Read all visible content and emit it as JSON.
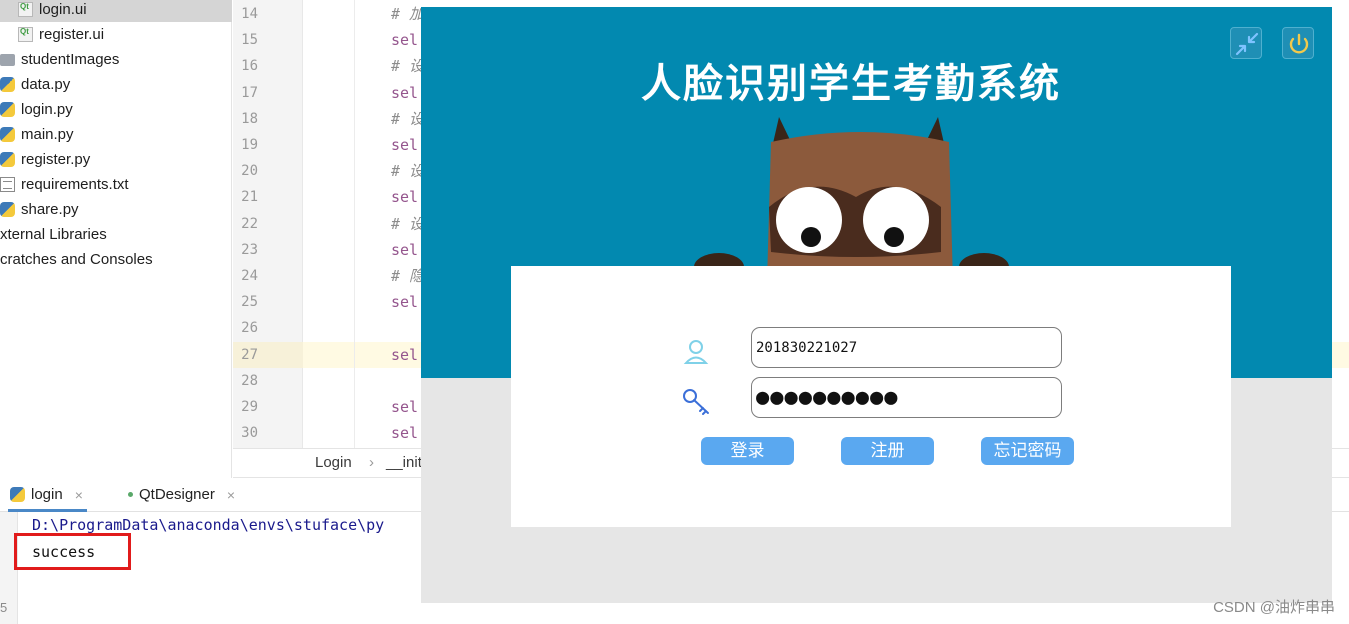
{
  "project_tree": {
    "items": [
      {
        "label": "login.ui",
        "icon": "qt-ui-file-icon",
        "indent": "deep",
        "selected": true
      },
      {
        "label": "register.ui",
        "icon": "qt-ui-file-icon",
        "indent": "deep",
        "selected": false
      },
      {
        "label": "studentImages",
        "icon": "folder-icon",
        "indent": "file",
        "selected": false
      },
      {
        "label": "data.py",
        "icon": "python-file-icon",
        "indent": "file",
        "selected": false
      },
      {
        "label": "login.py",
        "icon": "python-file-icon",
        "indent": "file",
        "selected": false
      },
      {
        "label": "main.py",
        "icon": "python-file-icon",
        "indent": "file",
        "selected": false
      },
      {
        "label": "register.py",
        "icon": "python-file-icon",
        "indent": "file",
        "selected": false
      },
      {
        "label": "requirements.txt",
        "icon": "text-file-icon",
        "indent": "file",
        "selected": false
      },
      {
        "label": "share.py",
        "icon": "python-file-icon",
        "indent": "file",
        "selected": false
      },
      {
        "label": "xternal Libraries",
        "icon": "",
        "indent": "root",
        "selected": false
      },
      {
        "label": "cratches and Consoles",
        "icon": "",
        "indent": "root",
        "selected": false
      }
    ]
  },
  "editor": {
    "line_numbers": [
      "14",
      "15",
      "16",
      "17",
      "18",
      "19",
      "20",
      "21",
      "22",
      "23",
      "24",
      "25",
      "26",
      "27",
      "28",
      "29",
      "30"
    ],
    "current_line": "27",
    "code_lines": [
      {
        "line": "14",
        "text": "# 加",
        "kind": "comment"
      },
      {
        "line": "15",
        "text": "sel",
        "kind": "code"
      },
      {
        "line": "16",
        "text": "# 设",
        "kind": "comment"
      },
      {
        "line": "17",
        "text": "sel",
        "kind": "code"
      },
      {
        "line": "18",
        "text": "# 设",
        "kind": "comment"
      },
      {
        "line": "19",
        "text": "sel",
        "kind": "code"
      },
      {
        "line": "20",
        "text": "# 设",
        "kind": "comment"
      },
      {
        "line": "21",
        "text": "sel",
        "kind": "code"
      },
      {
        "line": "22",
        "text": "# 设",
        "kind": "comment"
      },
      {
        "line": "23",
        "text": "sel",
        "kind": "code"
      },
      {
        "line": "24",
        "text": "# 隐",
        "kind": "comment"
      },
      {
        "line": "25",
        "text": "sel",
        "kind": "code"
      },
      {
        "line": "27",
        "text": "sel",
        "kind": "code"
      },
      {
        "line": "29",
        "text": "sel",
        "kind": "code"
      },
      {
        "line": "30",
        "text": "sel",
        "kind": "code"
      }
    ]
  },
  "breadcrumb": {
    "class_name": "Login",
    "separator": "›",
    "method": "__init"
  },
  "run_panel": {
    "tabs": [
      {
        "label": "login",
        "close": "×",
        "active": true
      },
      {
        "label": "QtDesigner",
        "close": "×",
        "active": false
      }
    ],
    "console": {
      "command_line": "D:\\ProgramData\\anaconda\\envs\\stuface\\py",
      "output": "success"
    },
    "gutter_glyph": "5"
  },
  "login_window": {
    "title": "人脸识别学生考勤系统",
    "username_value": "201830221027",
    "password_masked": "●●●●●●●●●●",
    "buttons": {
      "login": "登录",
      "register": "注册",
      "forgot_password": "忘记密码"
    },
    "colors": {
      "banner": "#0289b0",
      "button": "#5aa8f0",
      "card": "#ffffff"
    }
  },
  "watermark": "CSDN @油炸串串"
}
